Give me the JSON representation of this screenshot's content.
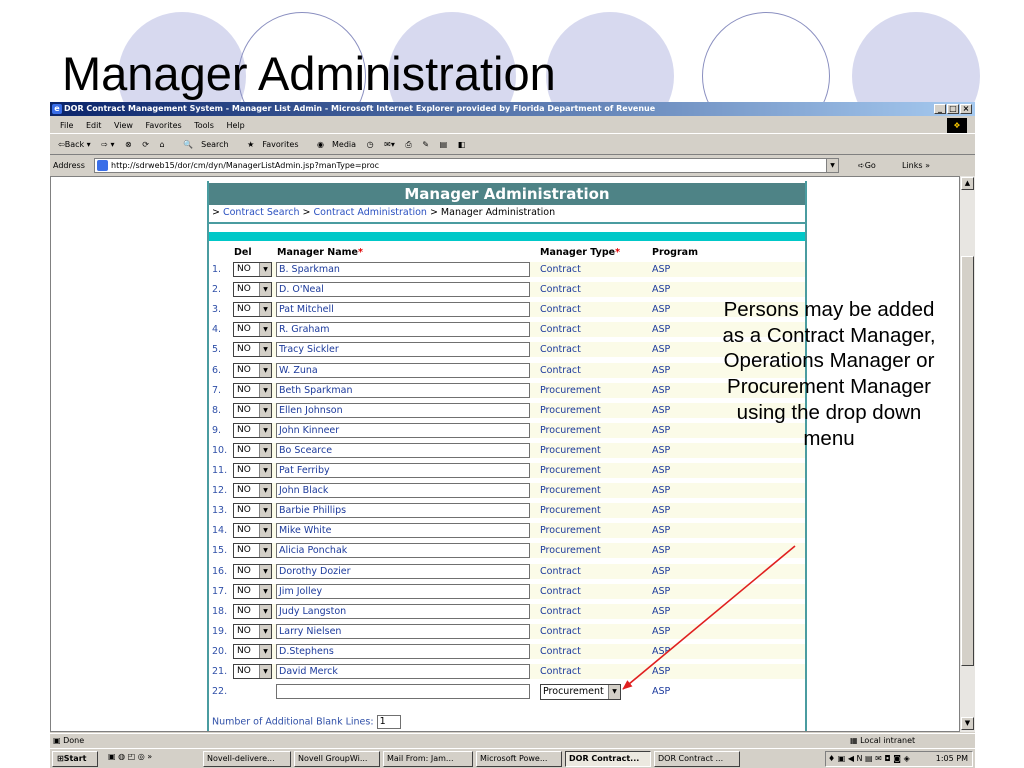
{
  "slide": {
    "title": "Manager Administration",
    "annotation": "Persons may be added as a Contract Manager, Operations Manager or Procurement Manager using the drop down menu"
  },
  "browser": {
    "window_title": "DOR Contract Management System - Manager List Admin - Microsoft Internet Explorer provided by Florida Department of Revenue",
    "menu": [
      "File",
      "Edit",
      "View",
      "Favorites",
      "Tools",
      "Help"
    ],
    "toolbar": {
      "back": "⇦Back ▾",
      "forward": "⇨ ▾",
      "search": "Search",
      "favorites": "Favorites",
      "media": "Media"
    },
    "address_label": "Address",
    "address_url": "http://sdrweb15/dor/cm/dyn/ManagerListAdmin.jsp?manType=proc",
    "go_label": "Go",
    "links_label": "Links »",
    "status_text": "Done",
    "zone_text": "Local intranet"
  },
  "page": {
    "header": "Manager Administration",
    "breadcrumb": {
      "prefix_1": "> ",
      "link_1": "Contract Search",
      "prefix_2": " > ",
      "link_2": "Contract Administration",
      "current": " > Manager Administration"
    },
    "columns": {
      "del": "Del",
      "name": "Manager Name",
      "type": "Manager Type",
      "program": "Program",
      "required_mark": "*"
    },
    "rows": [
      {
        "num": "1.",
        "del": "NO",
        "name": "B. Sparkman",
        "type": "Contract",
        "program": "ASP"
      },
      {
        "num": "2.",
        "del": "NO",
        "name": "D. O'Neal",
        "type": "Contract",
        "program": "ASP"
      },
      {
        "num": "3.",
        "del": "NO",
        "name": "Pat Mitchell",
        "type": "Contract",
        "program": "ASP"
      },
      {
        "num": "4.",
        "del": "NO",
        "name": "R. Graham",
        "type": "Contract",
        "program": "ASP"
      },
      {
        "num": "5.",
        "del": "NO",
        "name": "Tracy Sickler",
        "type": "Contract",
        "program": "ASP"
      },
      {
        "num": "6.",
        "del": "NO",
        "name": "W. Zuna",
        "type": "Contract",
        "program": "ASP"
      },
      {
        "num": "7.",
        "del": "NO",
        "name": "Beth Sparkman",
        "type": "Procurement",
        "program": "ASP"
      },
      {
        "num": "8.",
        "del": "NO",
        "name": "Ellen Johnson",
        "type": "Procurement",
        "program": "ASP"
      },
      {
        "num": "9.",
        "del": "NO",
        "name": "John Kinneer",
        "type": "Procurement",
        "program": "ASP"
      },
      {
        "num": "10.",
        "del": "NO",
        "name": "Bo Scearce",
        "type": "Procurement",
        "program": "ASP"
      },
      {
        "num": "11.",
        "del": "NO",
        "name": "Pat Ferriby",
        "type": "Procurement",
        "program": "ASP"
      },
      {
        "num": "12.",
        "del": "NO",
        "name": "John Black",
        "type": "Procurement",
        "program": "ASP"
      },
      {
        "num": "13.",
        "del": "NO",
        "name": "Barbie Phillips",
        "type": "Procurement",
        "program": "ASP"
      },
      {
        "num": "14.",
        "del": "NO",
        "name": "Mike White",
        "type": "Procurement",
        "program": "ASP"
      },
      {
        "num": "15.",
        "del": "NO",
        "name": "Alicia Ponchak",
        "type": "Procurement",
        "program": "ASP"
      },
      {
        "num": "16.",
        "del": "NO",
        "name": "Dorothy Dozier",
        "type": "Contract",
        "program": "ASP"
      },
      {
        "num": "17.",
        "del": "NO",
        "name": "Jim Jolley",
        "type": "Contract",
        "program": "ASP"
      },
      {
        "num": "18.",
        "del": "NO",
        "name": "Judy Langston",
        "type": "Contract",
        "program": "ASP"
      },
      {
        "num": "19.",
        "del": "NO",
        "name": "Larry Nielsen",
        "type": "Contract",
        "program": "ASP"
      },
      {
        "num": "20.",
        "del": "NO",
        "name": "D.Stephens",
        "type": "Contract",
        "program": "ASP"
      },
      {
        "num": "21.",
        "del": "NO",
        "name": "David Merck",
        "type": "Contract",
        "program": "ASP"
      }
    ],
    "new_row": {
      "num": "22.",
      "name": "",
      "type": "Procurement",
      "program": "ASP"
    },
    "blank_lines_label": "Number of Additional Blank Lines:",
    "blank_lines_value": "1"
  },
  "taskbar": {
    "start": "Start",
    "items": [
      "Novell-delivere...",
      "Novell GroupWi...",
      "Mail From: Jam...",
      "Microsoft Powe...",
      "DOR Contract...",
      "DOR Contract ..."
    ],
    "active_index": 4,
    "clock": "1:05 PM"
  }
}
